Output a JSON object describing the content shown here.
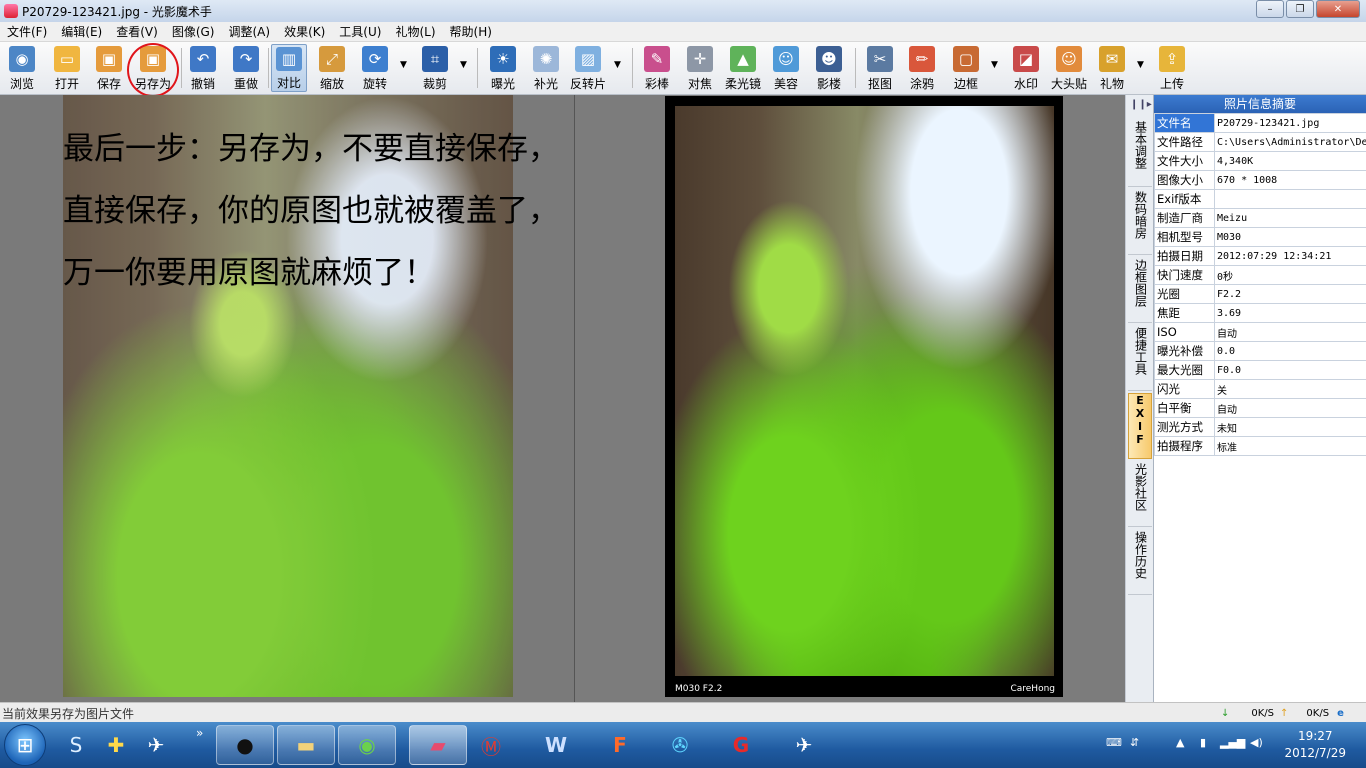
{
  "window": {
    "title": "P20729-123421.jpg - 光影魔术手",
    "min": "–",
    "max": "❐",
    "close": "✕"
  },
  "menu": [
    "文件(F)",
    "编辑(E)",
    "查看(V)",
    "图像(G)",
    "调整(A)",
    "效果(K)",
    "工具(U)",
    "礼物(L)",
    "帮助(H)"
  ],
  "toolbar": {
    "browse": "浏览",
    "open": "打开",
    "save": "保存",
    "save_as": "另存为",
    "undo": "撤销",
    "redo": "重做",
    "compare": "对比",
    "zoom": "缩放",
    "rotate": "旋转",
    "crop": "裁剪",
    "exposure": "曝光",
    "fill_light": "补光",
    "negative": "反转片",
    "color_wand": "彩棒",
    "focus": "对焦",
    "soft_lens": "柔光镜",
    "beauty": "美容",
    "studio": "影楼",
    "cutout": "抠图",
    "doodle": "涂鸦",
    "border": "边框",
    "watermark": "水印",
    "sticker": "大头贴",
    "gift": "礼物",
    "upload": "上传",
    "dropdown": "▼"
  },
  "overlay_text": [
    "最后一步：另存为，不要直接保存，",
    "直接保存，你的原图也就被覆盖了，",
    "万一你要用原图就麻烦了！"
  ],
  "photo_caption": {
    "left": "M030 F2.2",
    "right": "CareHong"
  },
  "side_tabs": {
    "collapse": "❙❙▸",
    "items": [
      "基本调整",
      "数码暗房",
      "边框图层",
      "便捷工具",
      "EXIF",
      "光影社区",
      "操作历史"
    ]
  },
  "info": {
    "title": "照片信息摘要",
    "rows": [
      {
        "k": "文件名",
        "v": "P20729-123421.jpg"
      },
      {
        "k": "文件路径",
        "v": "C:\\Users\\Administrator\\De"
      },
      {
        "k": "文件大小",
        "v": "4,340K"
      },
      {
        "k": "图像大小",
        "v": "670 * 1008"
      },
      {
        "k": "Exif版本",
        "v": ""
      },
      {
        "k": "制造厂商",
        "v": "Meizu"
      },
      {
        "k": "相机型号",
        "v": "M030"
      },
      {
        "k": "拍摄日期",
        "v": "2012:07:29 12:34:21"
      },
      {
        "k": "快门速度",
        "v": "0秒"
      },
      {
        "k": "光圈",
        "v": "F2.2"
      },
      {
        "k": "焦距",
        "v": "3.69"
      },
      {
        "k": "ISO",
        "v": "自动"
      },
      {
        "k": "曝光补偿",
        "v": "0.0"
      },
      {
        "k": "最大光圈",
        "v": "F0.0"
      },
      {
        "k": "闪光",
        "v": "关"
      },
      {
        "k": "白平衡",
        "v": "自动"
      },
      {
        "k": "测光方式",
        "v": "未知"
      },
      {
        "k": "拍摄程序",
        "v": "标准"
      }
    ]
  },
  "status": {
    "text": "当前效果另存为图片文件",
    "down": "0K/S",
    "up": "0K/S"
  },
  "taskbar": {
    "more": "»",
    "time": "19:27",
    "date": "2012/7/29"
  }
}
